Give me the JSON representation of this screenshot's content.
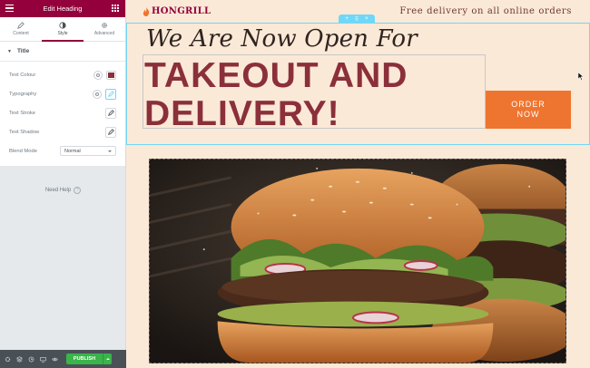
{
  "panel": {
    "title": "Edit Heading",
    "tabs": [
      {
        "label": "Content",
        "icon": "pencil-icon"
      },
      {
        "label": "Style",
        "icon": "half-circle-icon"
      },
      {
        "label": "Advanced",
        "icon": "gear-icon"
      }
    ],
    "section_title": "Title",
    "controls": {
      "text_colour": "Text Colour",
      "typography": "Typography",
      "text_stroke": "Text Stroke",
      "text_shadow": "Text Shadow",
      "blend_mode": "Blend Mode",
      "blend_mode_value": "Normal"
    },
    "text_colour_value": "#8b2f3b",
    "need_help": "Need Help",
    "publish": "PUBLISH",
    "accent": "#93003c"
  },
  "site": {
    "logo": "HONGRILL",
    "delivery": "Free delivery on all online orders",
    "headline_small": "We Are Now Open For",
    "headline_big_line1": "TAKEOUT AND",
    "headline_big_line2": "DELIVERY!",
    "order_line1": "ORDER",
    "order_line2": "NOW",
    "button_color": "#ee7530",
    "heading_color": "#8b2f3b"
  }
}
